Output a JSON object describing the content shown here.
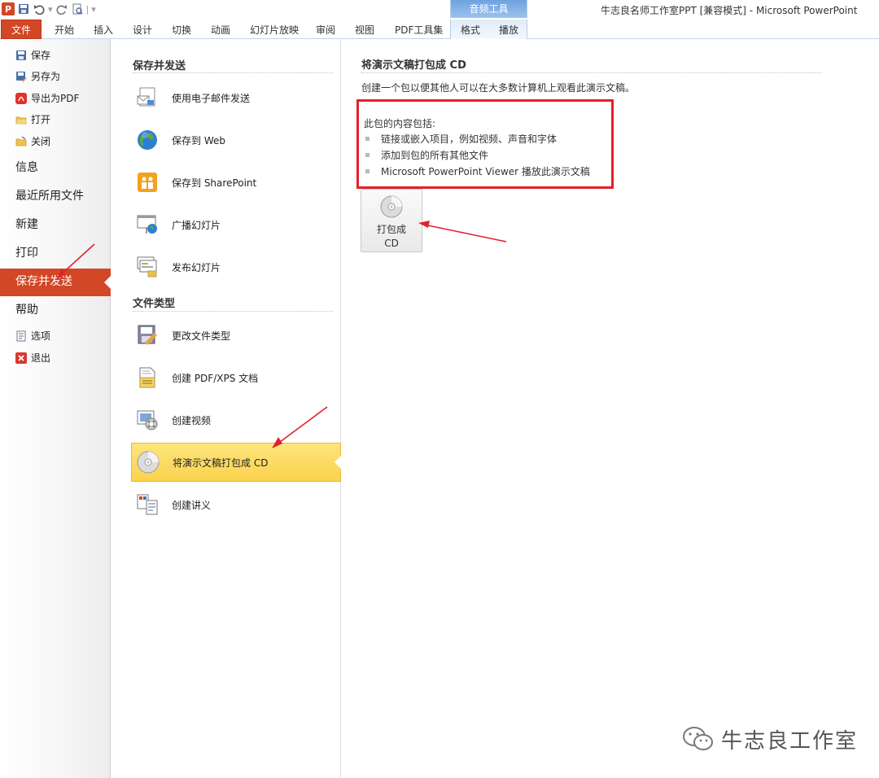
{
  "window": {
    "title": "牛志良名师工作室PPT [兼容模式]  -  Microsoft PowerPoint",
    "contextual_group": "音频工具",
    "app_icon": "P"
  },
  "quick_access": [
    "save-icon",
    "undo-icon",
    "redo-icon",
    "print-preview-icon",
    "customize-icon"
  ],
  "ribbon_tabs": [
    "文件",
    "开始",
    "插入",
    "设计",
    "切换",
    "动画",
    "幻灯片放映",
    "审阅",
    "视图",
    "PDF工具集",
    "格式",
    "播放"
  ],
  "nav": {
    "save": "保存",
    "save_as": "另存为",
    "export_pdf": "导出为PDF",
    "open": "打开",
    "close": "关闭",
    "info": "信息",
    "recent": "最近所用文件",
    "new": "新建",
    "print": "打印",
    "save_send": "保存并发送",
    "help": "帮助",
    "options": "选项",
    "exit": "退出"
  },
  "middle": {
    "section1": "保存并发送",
    "items1": [
      "使用电子邮件发送",
      "保存到 Web",
      "保存到 SharePoint",
      "广播幻灯片",
      "发布幻灯片"
    ],
    "section2": "文件类型",
    "items2": [
      "更改文件类型",
      "创建 PDF/XPS 文档",
      "创建视频",
      "将演示文稿打包成 CD",
      "创建讲义"
    ],
    "selected": "将演示文稿打包成 CD"
  },
  "right": {
    "title": "将演示文稿打包成 CD",
    "description": "创建一个包以便其他人可以在大多数计算机上观看此演示文稿。",
    "contents_label": "此包的内容包括:",
    "bullets": [
      "链接或嵌入项目，例如视频、声音和字体",
      "添加到包的所有其他文件",
      "Microsoft PowerPoint Viewer 播放此演示文稿"
    ],
    "button_label": "打包成 CD"
  },
  "watermark": "牛志良工作室",
  "colors": {
    "file_tab": "#d24726",
    "selected_nav": "#d24726",
    "selected_item": "#fbd24d",
    "annotation": "#e5202b",
    "contextual_group": "#6ea2df"
  }
}
